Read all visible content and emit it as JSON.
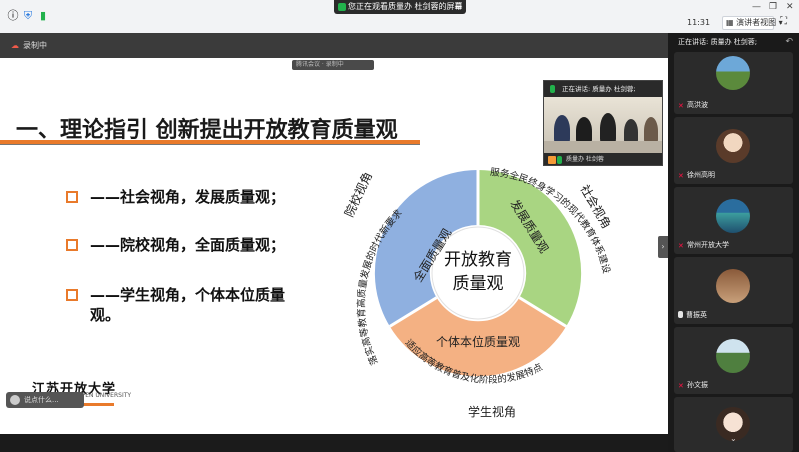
{
  "screen_share_banner": "您正在观看质量办 杜剑蓉的屏幕",
  "clock": "11:31",
  "view_button_label": "演讲者视图",
  "recording_label": "录制中",
  "meeting_tag": "腾讯会议 · 录制中",
  "slide": {
    "title": "一、理论指引 创新提出开放教育质量观",
    "bullets": [
      "——社会视角，发展质量观；",
      "——院校视角，全面质量观；",
      "——学生视角，个体本位质量"
    ],
    "bullet3_cont": "观。",
    "diagram": {
      "center": [
        "开放教育",
        "质量观"
      ],
      "segments": [
        {
          "label": "全面质量观",
          "color": "#8fb0e0"
        },
        {
          "label": "发展质量观",
          "color": "#a9d582"
        },
        {
          "label": "个体本位质量观",
          "color": "#f4b183"
        }
      ],
      "outer_texts": {
        "left_arc": "落实高等教育高质量发展的时代新要求",
        "right_arc": "服务全民终身学习的现代教育体系建设",
        "bottom_arc": "适应高等教育普及化阶段的发展特点"
      },
      "perspectives": {
        "left": "院校视角",
        "right": "社会视角",
        "bottom": "学生视角"
      }
    },
    "logo_text": "江苏开放大学",
    "logo_sub": "JIANGSU OPEN UNIVERSITY",
    "chat_chip": "说点什么..."
  },
  "small_video": {
    "speaking": "正在讲话: 质量办 杜剑蓉;",
    "name": "质量办 杜剑蓉"
  },
  "right_panel": {
    "header": "正在讲话: 质量办 杜剑蓉;",
    "participants": [
      {
        "name": "高洪波",
        "mic": "off"
      },
      {
        "name": "徐州高明",
        "mic": "off"
      },
      {
        "name": "常州开放大学",
        "mic": "off"
      },
      {
        "name": "曹振英",
        "mic": "on"
      },
      {
        "name": "孙文振",
        "mic": "off"
      },
      {
        "name": "",
        "mic": "off"
      }
    ]
  },
  "colors": {
    "accent_orange": "#e97a2b",
    "seg_blue": "#8fb0e0",
    "seg_green": "#a9d582",
    "seg_orange": "#f4b183"
  }
}
